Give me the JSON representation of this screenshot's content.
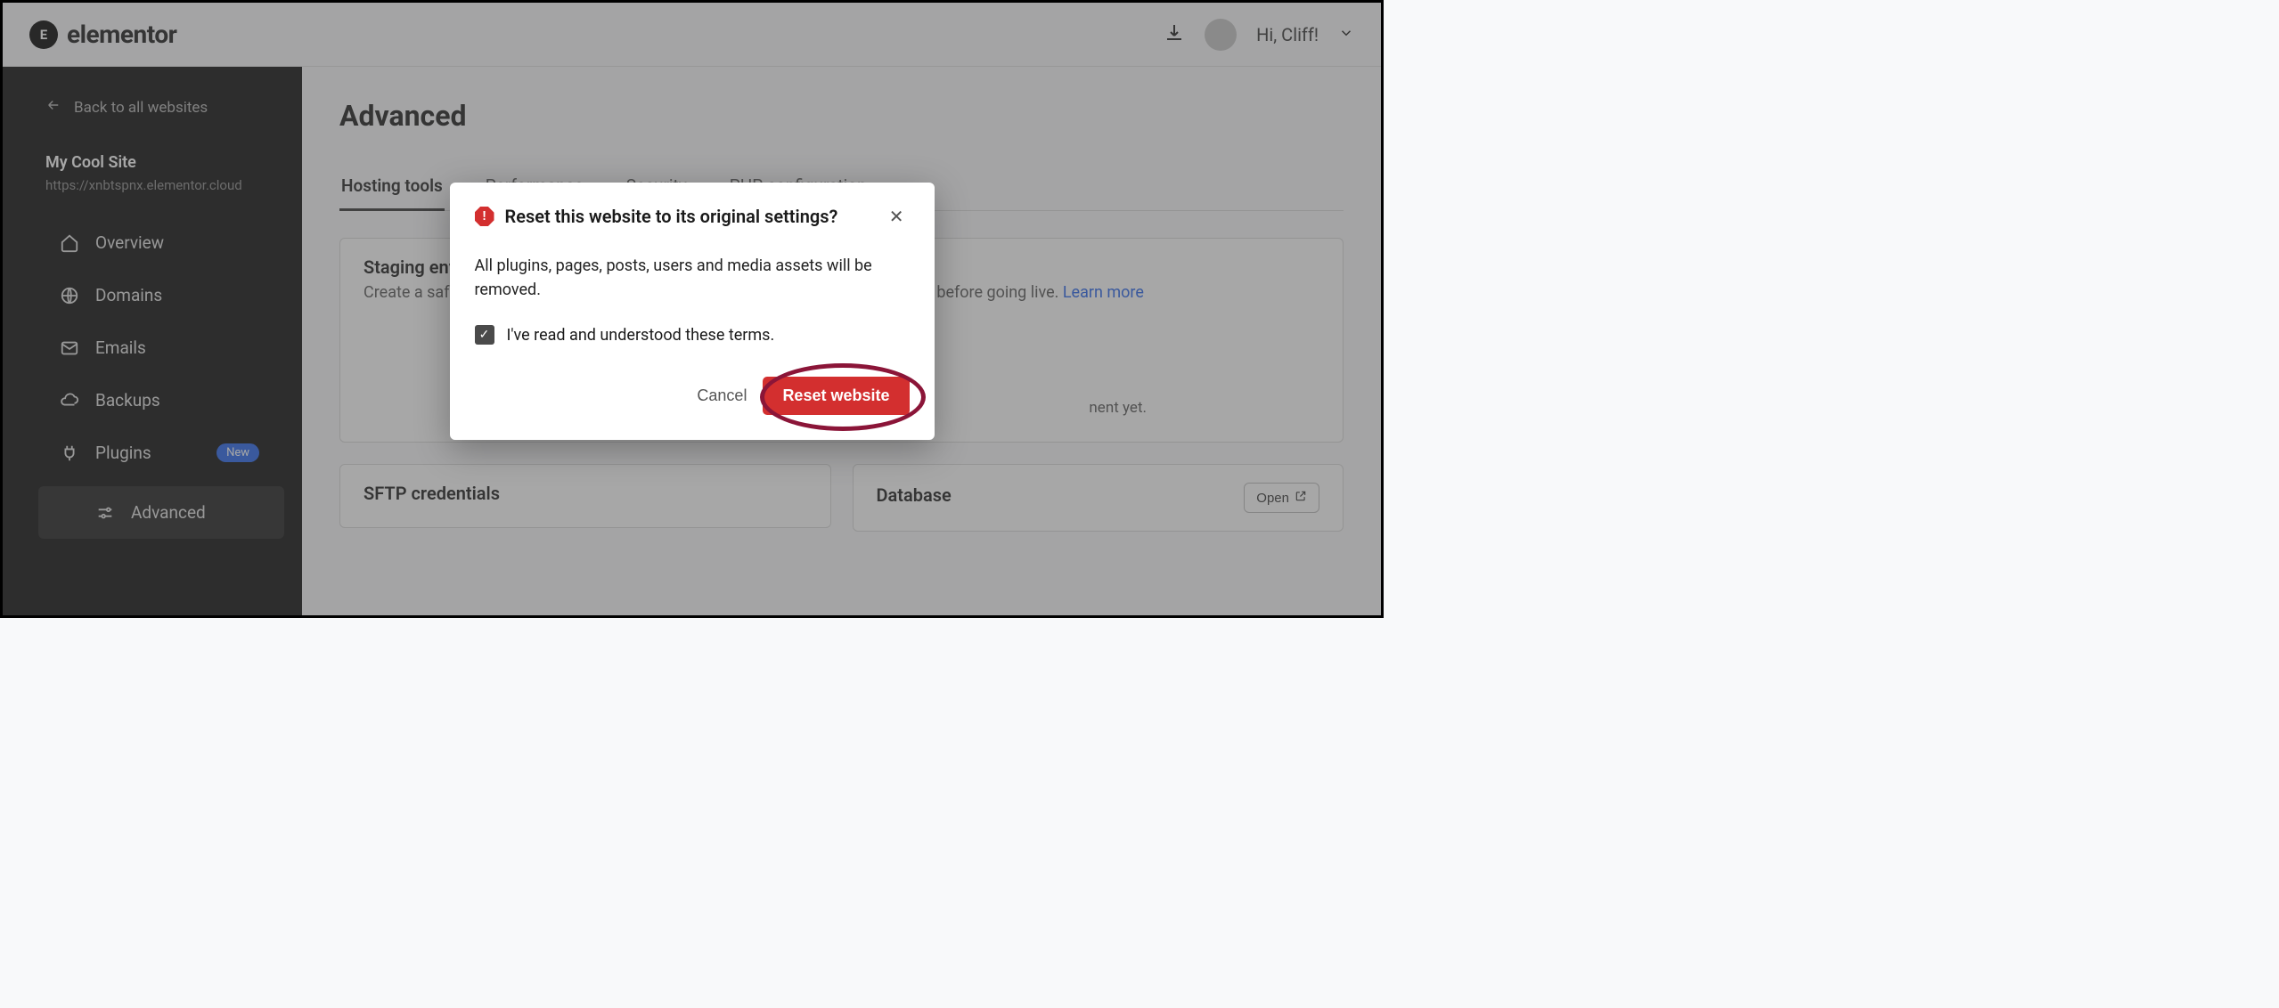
{
  "header": {
    "brand": "elementor",
    "greeting": "Hi, Cliff!"
  },
  "sidebar": {
    "back_label": "Back to all websites",
    "site_name": "My Cool Site",
    "site_url": "https://xnbtspnx.elementor.cloud",
    "items": [
      {
        "label": "Overview"
      },
      {
        "label": "Domains"
      },
      {
        "label": "Emails"
      },
      {
        "label": "Backups"
      },
      {
        "label": "Plugins",
        "badge": "New"
      },
      {
        "label": "Advanced",
        "active": true
      }
    ]
  },
  "main": {
    "title": "Advanced",
    "tabs": [
      {
        "label": "Hosting tools",
        "active": true
      },
      {
        "label": "Performance"
      },
      {
        "label": "Security"
      },
      {
        "label": "PHP configuration"
      }
    ],
    "staging": {
      "title": "Staging environment",
      "desc_prefix": "Create a safe d",
      "desc_suffix": "esign changes before going live. ",
      "learn_more": "Learn more",
      "empty_suffix": "nent yet."
    },
    "sftp": {
      "title": "SFTP credentials"
    },
    "database": {
      "title": "Database",
      "open": "Open"
    }
  },
  "modal": {
    "title": "Reset this website to its original settings?",
    "body": "All plugins, pages, posts, users and media assets will be removed.",
    "checkbox_label": "I've read and understood these terms.",
    "cancel": "Cancel",
    "confirm": "Reset website"
  }
}
